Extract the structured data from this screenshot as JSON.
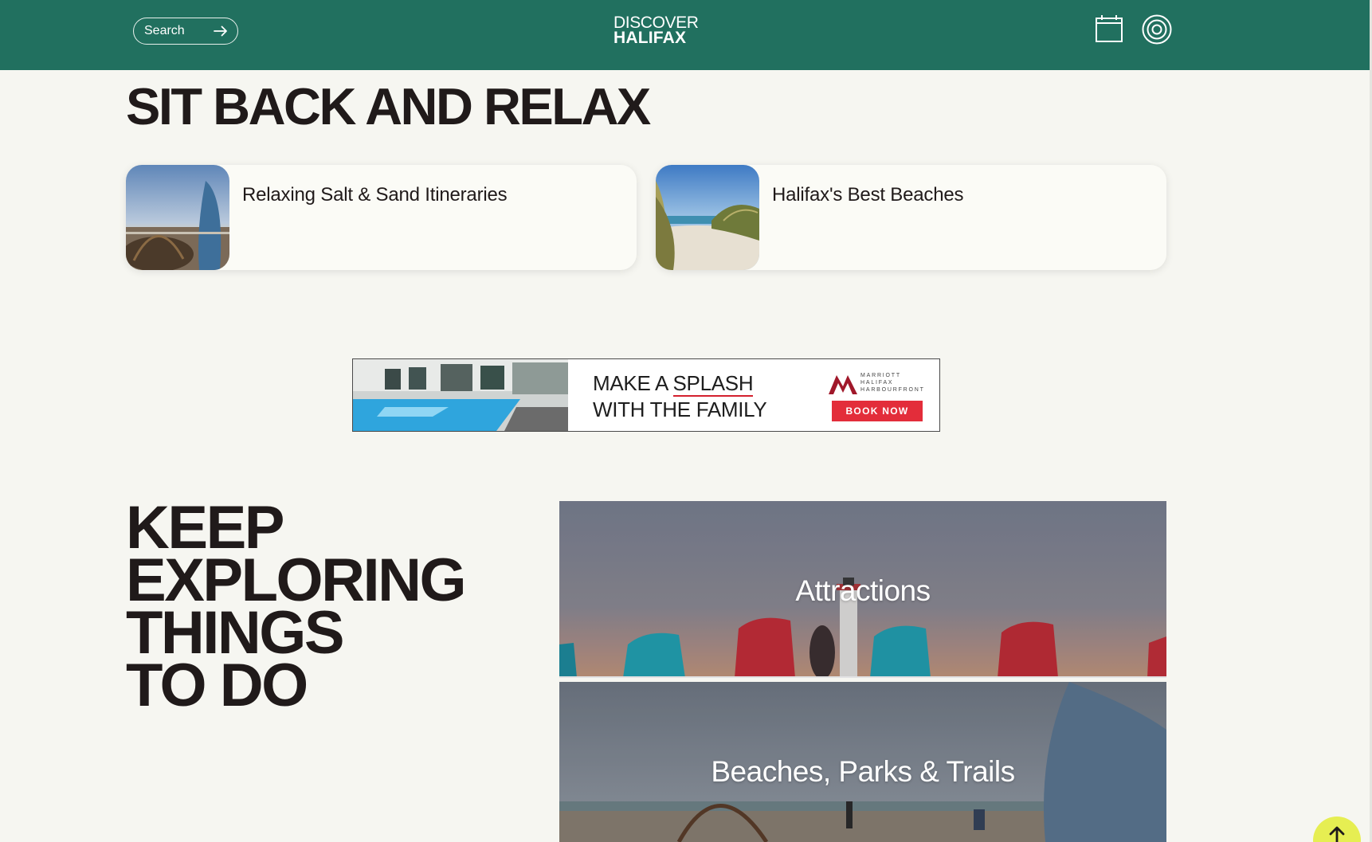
{
  "header": {
    "search_label": "Search",
    "logo_line1": "DISCOVER",
    "logo_line2": "HALIFAX",
    "icons": [
      "calendar-icon",
      "target-icon",
      "arrow-right-icon"
    ],
    "brand_color": "#21705f"
  },
  "relax": {
    "title": "SIT BACK AND RELAX",
    "cards": [
      {
        "title": "Relaxing Salt & Sand Itineraries"
      },
      {
        "title": "Halifax's Best Beaches"
      }
    ]
  },
  "ad": {
    "headline_line1_pre": "MAKE A ",
    "headline_line1_em": "SPLASH",
    "headline_line2": "WITH THE FAMILY",
    "brand_line1": "MARRIOTT",
    "brand_line2": "HALIFAX",
    "brand_line3": "HARBOURFRONT",
    "cta_label": "BOOK NOW",
    "cta_color": "#e32d3a"
  },
  "explore": {
    "title_lines": [
      "KEEP",
      "EXPLORING",
      "THINGS",
      "TO DO"
    ],
    "tiles": [
      {
        "label": "Attractions"
      },
      {
        "label": "Beaches, Parks & Trails"
      }
    ]
  },
  "back_to_top": {
    "icon": "arrow-up-icon",
    "color": "#e6ee52"
  }
}
